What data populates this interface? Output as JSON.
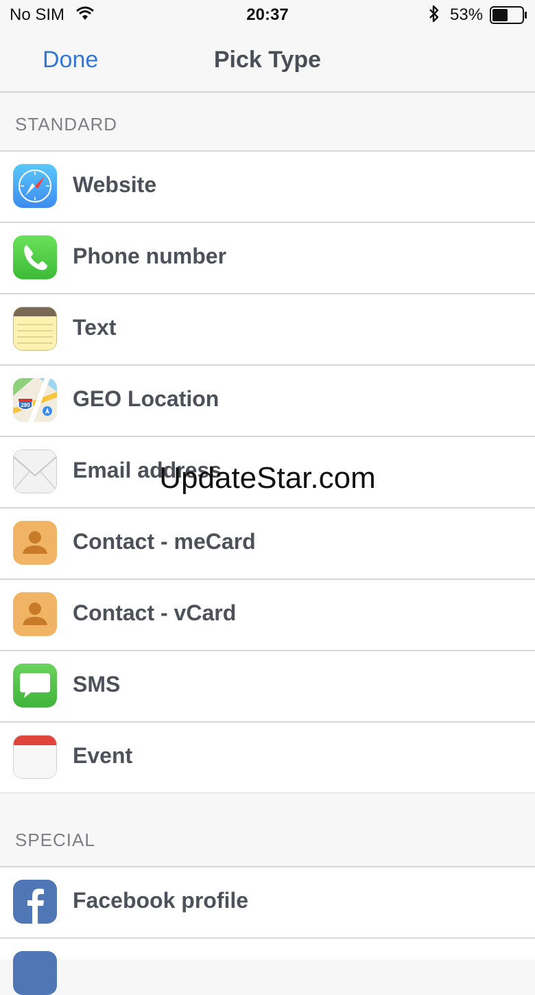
{
  "status_bar": {
    "carrier": "No SIM",
    "time": "20:37",
    "battery_percent": "53%",
    "battery_level": 0.53
  },
  "nav": {
    "done_label": "Done",
    "title": "Pick Type"
  },
  "sections": {
    "standard": {
      "header": "STANDARD",
      "items": [
        {
          "label": "Website",
          "icon": "safari-compass-icon"
        },
        {
          "label": "Phone number",
          "icon": "phone-icon"
        },
        {
          "label": "Text",
          "icon": "notes-icon"
        },
        {
          "label": "GEO Location",
          "icon": "maps-icon"
        },
        {
          "label": "Email address",
          "icon": "mail-envelope-icon"
        },
        {
          "label": "Contact - meCard",
          "icon": "contact-icon"
        },
        {
          "label": "Contact - vCard",
          "icon": "contact-icon"
        },
        {
          "label": "SMS",
          "icon": "messages-icon"
        },
        {
          "label": "Event",
          "icon": "calendar-icon"
        }
      ]
    },
    "special": {
      "header": "SPECIAL",
      "items": [
        {
          "label": "Facebook profile",
          "icon": "facebook-icon"
        }
      ]
    }
  },
  "maps_icon_text": "280",
  "watermark": "UpdateStar.com",
  "colors": {
    "accent": "#3478d6",
    "row_text": "#4d525a",
    "section_text": "#7d8086",
    "separator": "#d8d8da",
    "background": "#f7f7f7"
  }
}
